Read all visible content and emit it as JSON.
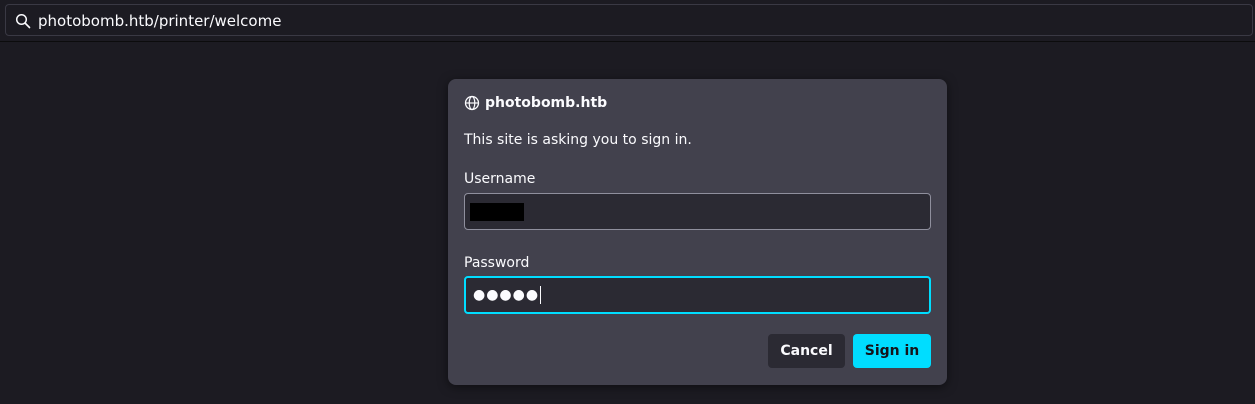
{
  "urlbar": {
    "url": "photobomb.htb/printer/welcome"
  },
  "dialog": {
    "host": "photobomb.htb",
    "message": "This site is asking you to sign in.",
    "username_label": "Username",
    "username_value": "",
    "password_label": "Password",
    "password_masked": "●●●●●",
    "cancel_label": "Cancel",
    "signin_label": "Sign in"
  },
  "colors": {
    "background": "#1c1b22",
    "dialog_bg": "#42414d",
    "accent": "#00ddff",
    "input_bg": "#2b2a33"
  },
  "icons": {
    "urlbar": "search-icon",
    "dialog_header": "globe-icon"
  }
}
